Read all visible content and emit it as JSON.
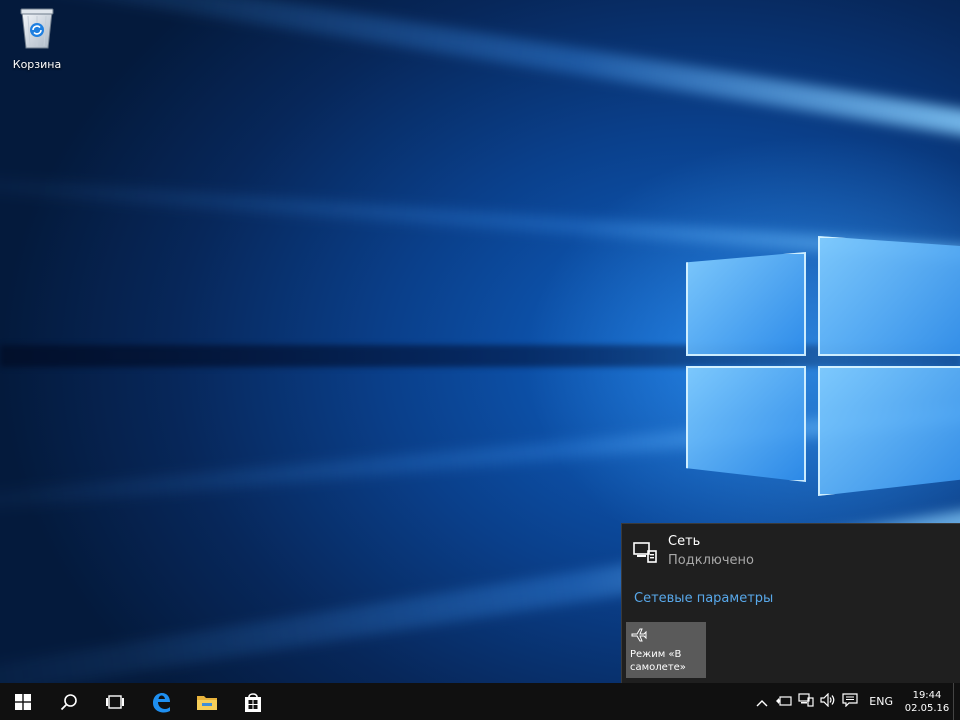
{
  "desktop": {
    "icons": [
      {
        "label": "Корзина",
        "icon": "recycle-bin-icon"
      }
    ]
  },
  "network_flyout": {
    "network": {
      "name": "Сеть",
      "status": "Подключено",
      "icon": "ethernet-icon"
    },
    "settings_link": "Сетевые параметры",
    "quick_actions": [
      {
        "label": "Режим «В самолете»",
        "icon": "airplane-icon",
        "active": false
      }
    ]
  },
  "taskbar": {
    "buttons": [
      {
        "name": "start-button",
        "icon": "windows-logo-icon"
      },
      {
        "name": "search-button",
        "icon": "search-icon"
      },
      {
        "name": "task-view-button",
        "icon": "task-view-icon"
      },
      {
        "name": "edge-button",
        "icon": "edge-browser-icon"
      },
      {
        "name": "file-explorer-button",
        "icon": "folder-icon"
      },
      {
        "name": "store-button",
        "icon": "store-bag-icon"
      }
    ],
    "tray": {
      "icons": [
        "chevron-up-icon",
        "battery-icon",
        "network-icon",
        "volume-icon",
        "notification-icon"
      ],
      "language": "ENG",
      "time": "19:44",
      "date": "02.05.16"
    }
  },
  "colors": {
    "accent_link": "#58a8ea",
    "flyout_bg": "#1f1f1f",
    "taskbar_bg": "#101010",
    "tile_bg": "#5a5a5a"
  }
}
